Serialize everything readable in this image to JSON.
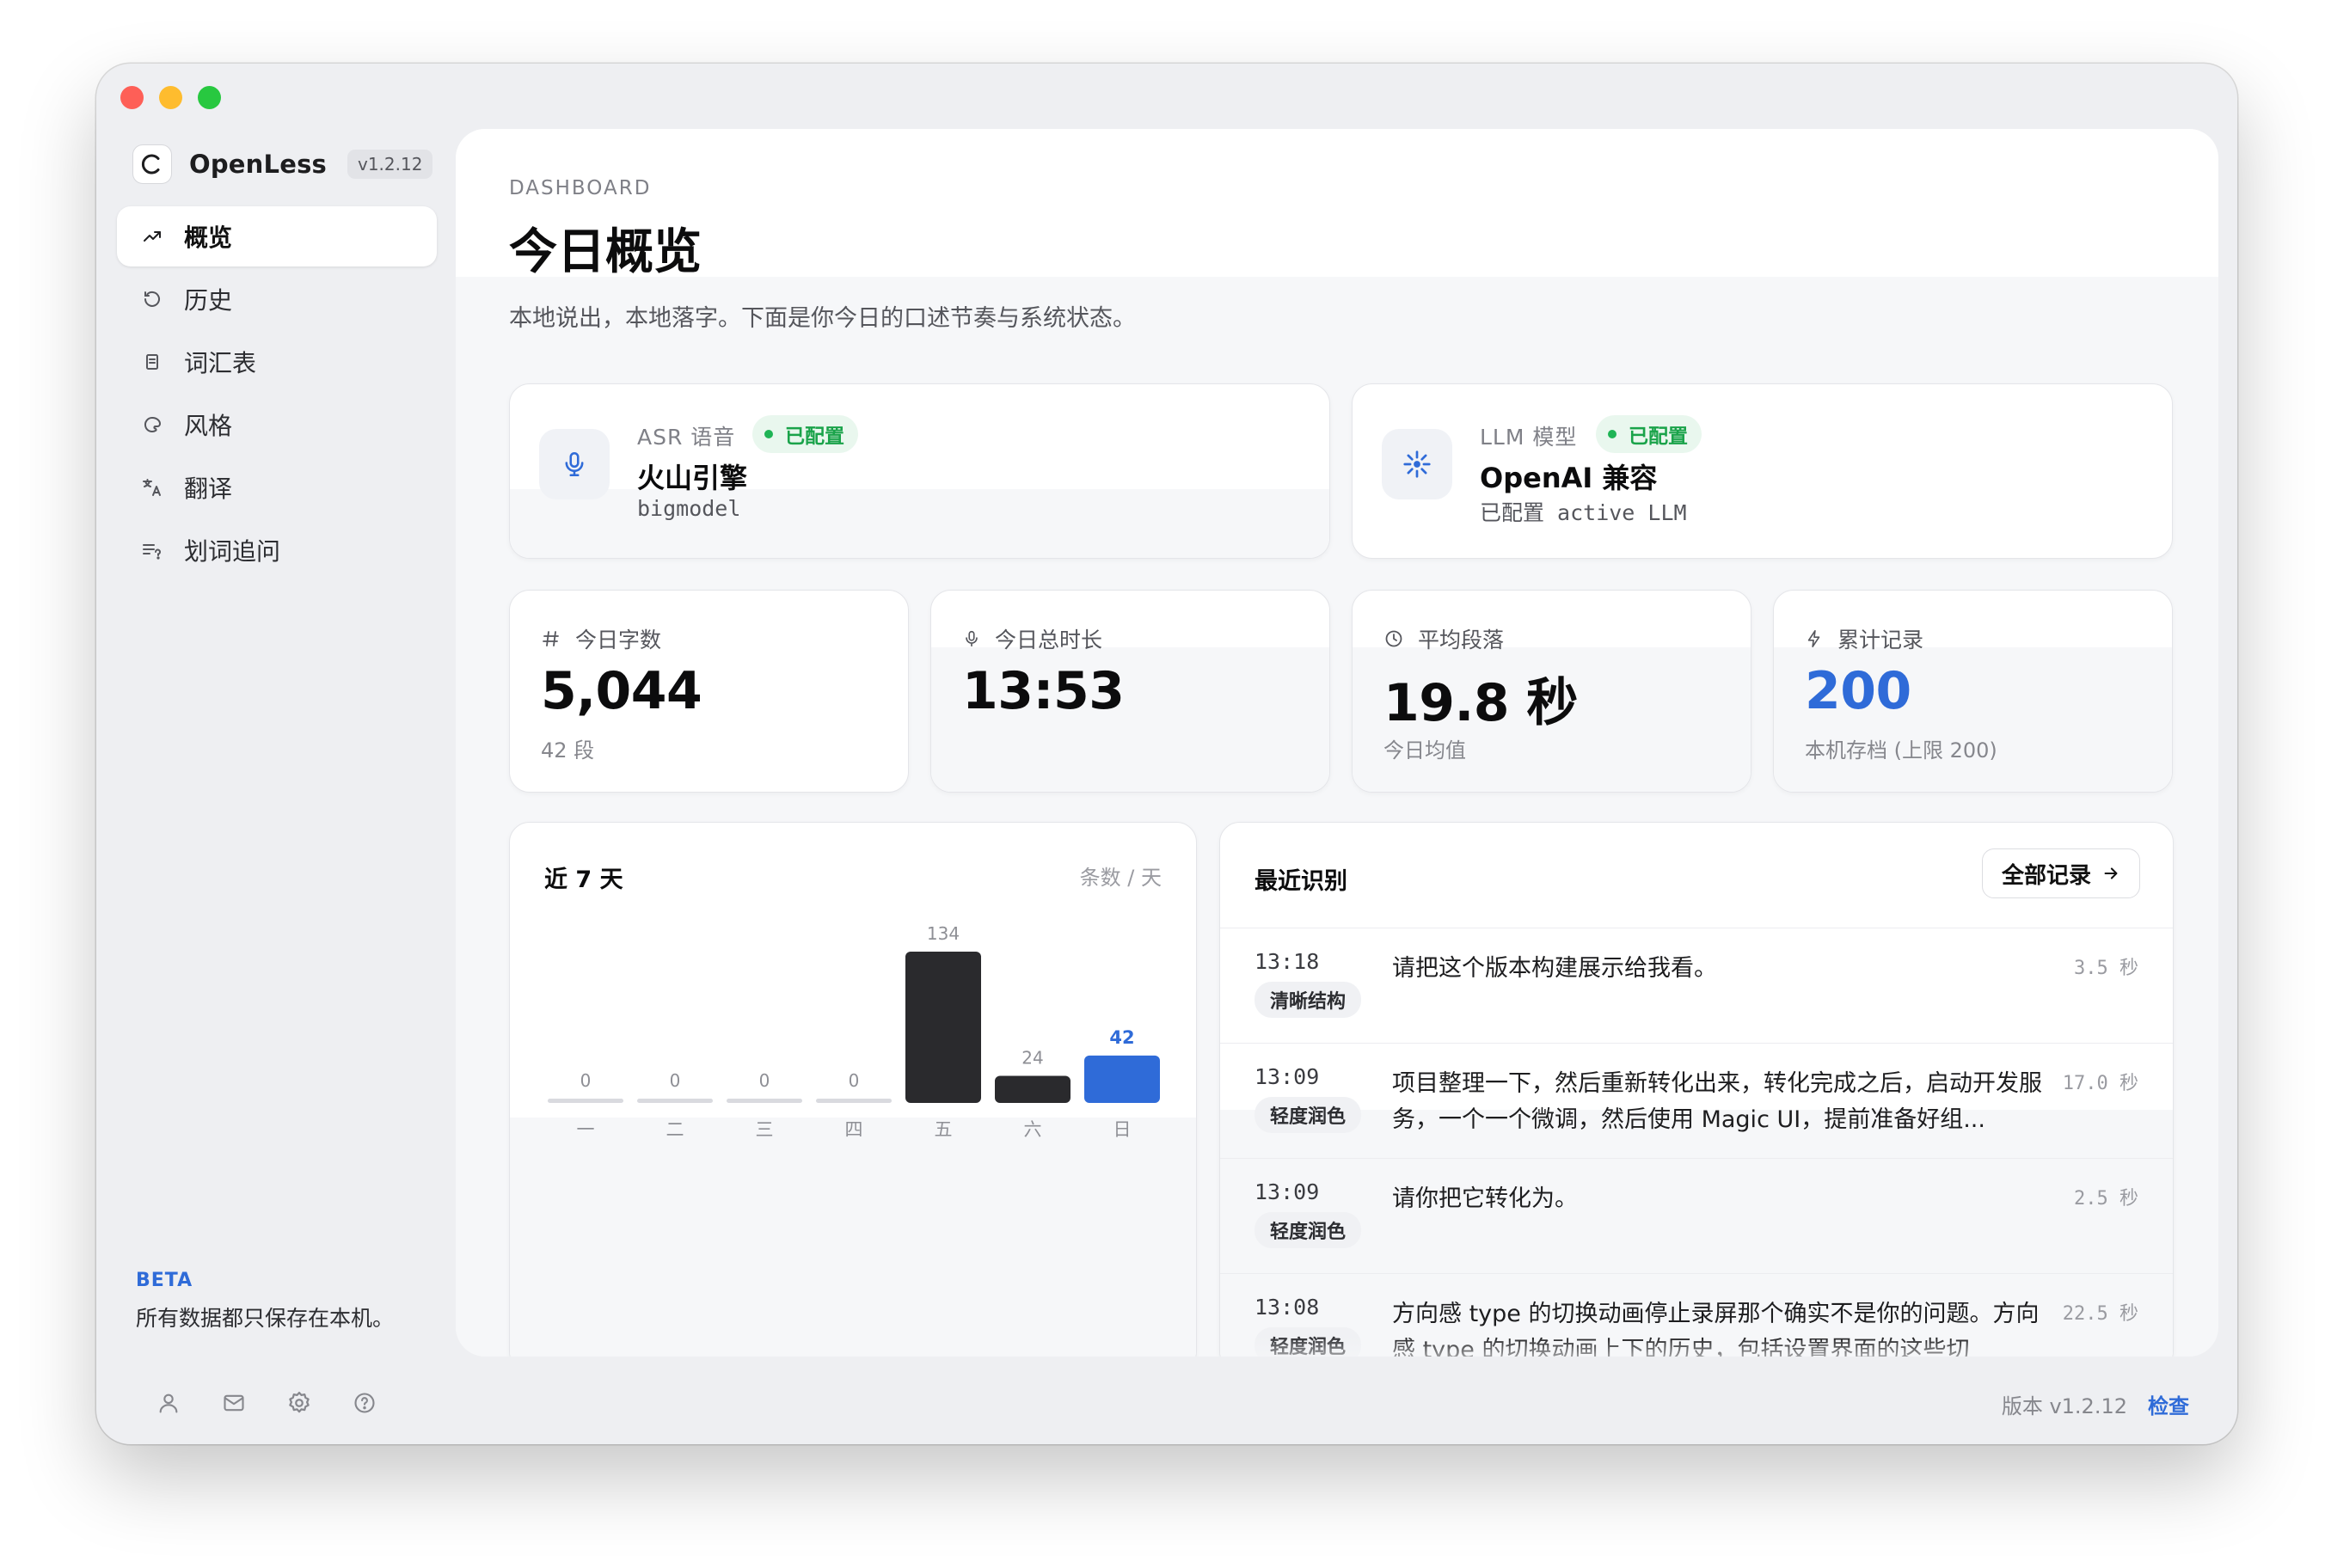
{
  "app": {
    "name": "OpenLess",
    "version": "v1.2.12"
  },
  "sidebar": {
    "items": [
      {
        "label": "概览",
        "icon": "trend-icon"
      },
      {
        "label": "历史",
        "icon": "history-icon"
      },
      {
        "label": "词汇表",
        "icon": "glossary-icon"
      },
      {
        "label": "风格",
        "icon": "style-icon"
      },
      {
        "label": "翻译",
        "icon": "translate-icon"
      },
      {
        "label": "划词追问",
        "icon": "ask-icon"
      }
    ],
    "beta": "BETA",
    "note": "所有数据都只保存在本机。"
  },
  "footer": {
    "version_text": "版本 v1.2.12",
    "check_label": "检查"
  },
  "header": {
    "eyebrow": "DASHBOARD",
    "title": "今日概览",
    "subtitle": "本地说出，本地落字。下面是你今日的口述节奏与系统状态。"
  },
  "config": {
    "asr": {
      "label": "ASR 语音",
      "status": "已配置",
      "name": "火山引擎",
      "sub": "bigmodel"
    },
    "llm": {
      "label": "LLM 模型",
      "status": "已配置",
      "name": "OpenAI 兼容",
      "sub": "已配置 active LLM"
    }
  },
  "stats": [
    {
      "label": "今日字数",
      "value": "5,044",
      "sub": "42 段",
      "icon": "hash-icon"
    },
    {
      "label": "今日总时长",
      "value": "13:53",
      "sub": "",
      "icon": "mic-icon"
    },
    {
      "label": "平均段落",
      "value": "19.8 秒",
      "sub": "今日均值",
      "icon": "clock-icon"
    },
    {
      "label": "累计记录",
      "value": "200",
      "sub": "本机存档 (上限 200)",
      "icon": "bolt-icon"
    }
  ],
  "chart": {
    "title": "近 7 天",
    "unit": "条数 / 天"
  },
  "chart_data": {
    "type": "bar",
    "title": "近 7 天",
    "xlabel": "",
    "ylabel": "条数 / 天",
    "categories": [
      "一",
      "二",
      "三",
      "四",
      "五",
      "六",
      "日"
    ],
    "values": [
      0,
      0,
      0,
      0,
      134,
      24,
      42
    ],
    "highlight_index": 6,
    "ylim": [
      0,
      134
    ],
    "grid": false,
    "colors": {
      "bar": "#2a2a2d",
      "highlight": "#2f6bd8",
      "empty": "#d9dadf",
      "highlight_label": "#2f6bd8"
    }
  },
  "recent": {
    "title": "最近识别",
    "all_label": "全部记录",
    "items": [
      {
        "time": "13:18",
        "tag": "清晰结构",
        "text": "请把这个版本构建展示给我看。",
        "duration": "3.5 秒"
      },
      {
        "time": "13:09",
        "tag": "轻度润色",
        "text": "项目整理一下，然后重新转化出来，转化完成之后，启动开发服务，一个一个微调，然后使用 Magic UI，提前准备好组...",
        "duration": "17.0 秒"
      },
      {
        "time": "13:09",
        "tag": "轻度润色",
        "text": "请你把它转化为。",
        "duration": "2.5 秒"
      },
      {
        "time": "13:08",
        "tag": "轻度润色",
        "text": "方向感 type 的切换动画停止录屏那个确实不是你的问题。方向感 type 的切换动画上下的历史，包括设置界面的这些切",
        "duration": "22.5 秒"
      }
    ]
  }
}
